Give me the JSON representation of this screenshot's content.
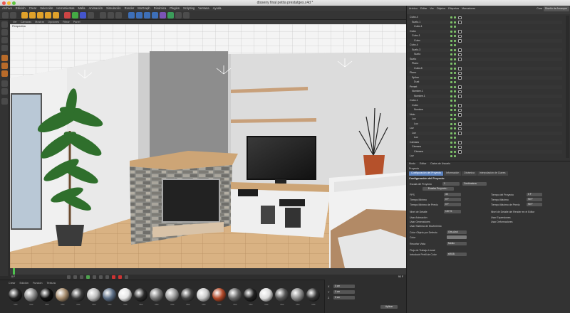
{
  "window": {
    "title": "disseny final petita prestatges.c4d *"
  },
  "menubar": [
    "Archivo",
    "Edición",
    "Crear",
    "Selección",
    "Herramientas",
    "Malla",
    "Animación",
    "Simulación",
    "Render",
    "MoGraph",
    "Dinámica",
    "Plugins",
    "Scripting",
    "Ventana",
    "Ayuda"
  ],
  "viewport_menu": [
    "Ver",
    "Cámaras",
    "Mostrar",
    "Opciones",
    "Filtrar",
    "Panel"
  ],
  "viewport_label": "Perspectiva",
  "object_manager": {
    "menu": [
      "Archivo",
      "Editar",
      "Ver",
      "Objetos",
      "Etiquetas",
      "Marcadores"
    ],
    "cinema_label": "Cara",
    "layout_label": "Diseño de Arranque",
    "objects": [
      "Cubo.4",
      "Suelo.1",
      "Cubo.1",
      "Cubo",
      "Cubo.1",
      "Cubo",
      "Cubo.4",
      "Suelo.3",
      "Suelo",
      "Suelo",
      "Plano",
      "Cubo.8",
      "Plano",
      "Spline",
      "Dust",
      "Preset",
      "Nombre.1",
      "Nombre.1",
      "Cubo.1",
      "Cubo",
      "Nombre",
      "Nulo",
      "Luz",
      "Luz",
      "Luz",
      "Luz",
      "Luz",
      "Cámara",
      "Cámara",
      "Cámara",
      "Luz"
    ]
  },
  "attribute_manager": {
    "menu": [
      "Modo",
      "Editar",
      "Datos de Usuario"
    ],
    "title": "Proyecto",
    "tabs": [
      "Configuración del Proyecto",
      "Información",
      "Dinámica",
      "Interpolación de Claves"
    ],
    "section": "Configuración del Proyecto",
    "scale_label": "Escala del Proyecto",
    "scale_value": "1",
    "scale_unit": "Centímetros",
    "scale_button": "Escalar Proyecto...",
    "fps_label": "FPS",
    "fps_value": "30",
    "min_time_label": "Tiempo Mínimo",
    "min_time_value": "0 F",
    "preview_min_label": "Tiempo Mínimo de Previo",
    "preview_min_value": "0 F",
    "lod_label": "Nivel de Detalle",
    "lod_value": "100 %",
    "use_anim": "Usar Animación",
    "use_gen": "Usar Generadores",
    "use_motion": "Usar Sistema de Movimiento",
    "project_time_label": "Tiempo del Proyecto",
    "project_time_value": "0 F",
    "max_time_label": "Tiempo Máximo",
    "max_time_value": "90 F",
    "preview_max_label": "Tiempo Máximo de Previo",
    "preview_max_value": "90 F",
    "render_lod": "Nivel de Detalle del Render en el Editor",
    "use_expr": "Usar Expresiones",
    "use_deform": "Usar Deformadores",
    "color_label": "Color Objeto por Defecto",
    "color_value": "Gris-Azul",
    "color2_label": "Color",
    "clipping_label": "Recortar Vista",
    "clipping_value": "Medio",
    "linear_label": "Flujo de Trabajo Lineal",
    "profile_label": "Introducir Perfil de Color",
    "profile_value": "sRGB",
    "apply_button": "Aplicar"
  },
  "timeline": {
    "start": "0 F",
    "end": "90 F",
    "ticks": [
      "0",
      "5",
      "10",
      "15",
      "20",
      "25",
      "30",
      "35",
      "40",
      "45",
      "50",
      "55",
      "60",
      "65",
      "70",
      "75",
      "80",
      "85",
      "90"
    ]
  },
  "material_manager": {
    "menu": [
      "Crear",
      "Edición",
      "Función",
      "Textura"
    ],
    "materials": [
      "Mat",
      "Mat",
      "Mat",
      "Mat",
      "Mat",
      "Mat",
      "Mat",
      "Mat",
      "Mat",
      "Mat",
      "Mat",
      "Mat",
      "Mat",
      "Mat",
      "Mat",
      "Mat",
      "Mat",
      "Mat",
      "Mat",
      "Mat"
    ]
  },
  "coordinates": {
    "labels": [
      "X",
      "Y",
      "Z"
    ],
    "values": [
      "0 cm",
      "0 cm",
      "0 cm"
    ],
    "apply": "Aplicar"
  }
}
